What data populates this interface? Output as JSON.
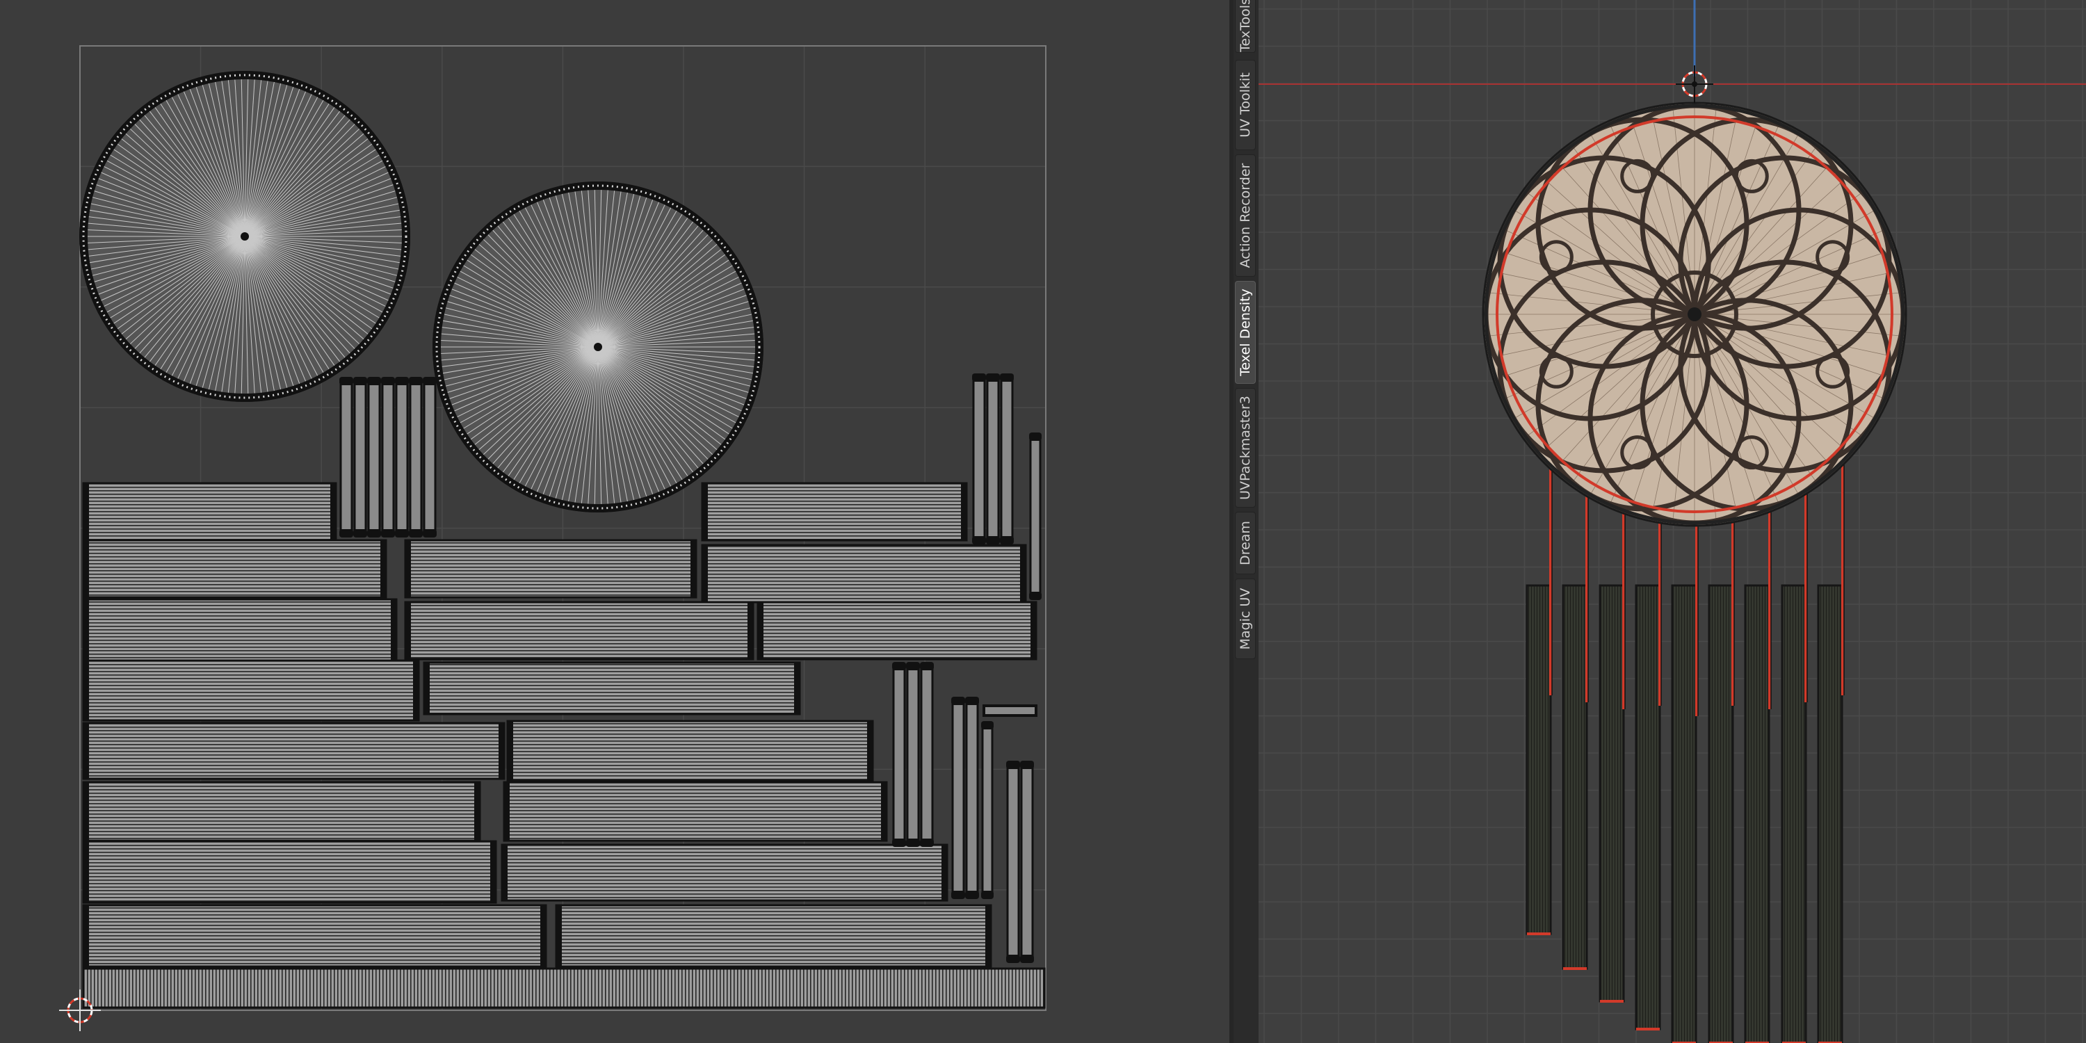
{
  "app": {
    "name": "Blender",
    "left_editor": "UV Editor",
    "right_editor": "3D Viewport"
  },
  "sidebar": {
    "tabs": [
      {
        "label": "TexTools",
        "active": false
      },
      {
        "label": "UV Toolkit",
        "active": false
      },
      {
        "label": "Action Recorder",
        "active": false
      },
      {
        "label": "Texel Density",
        "active": true
      },
      {
        "label": "UVPackmaster3",
        "active": false
      },
      {
        "label": "Dream",
        "active": false
      },
      {
        "label": "Magic UV",
        "active": false
      }
    ]
  },
  "uv_editor": {
    "content": "UV layout of a wind chime: two radial disc islands, vertical rod strips and rows of horizontal rectangular strip islands",
    "cursor_icon": "2d-cursor-icon"
  },
  "viewport": {
    "content": "Front view of a textured wind chime: circular disc with floral pattern, red outline edges and nine hanging rods",
    "cursor_icon": "3d-cursor-icon"
  },
  "colors": {
    "uv_background": "#3c3c3c",
    "viewport_background": "#3f3f3f",
    "grid_line": "#4a4a4a",
    "uv_fill": "#aaaaaa",
    "selection_red": "#d23a2a",
    "x_axis_red": "#a83232",
    "z_axis_blue": "#3d6fb3",
    "disc_texture": "#c9b7a4",
    "tab_active": "#474747"
  }
}
